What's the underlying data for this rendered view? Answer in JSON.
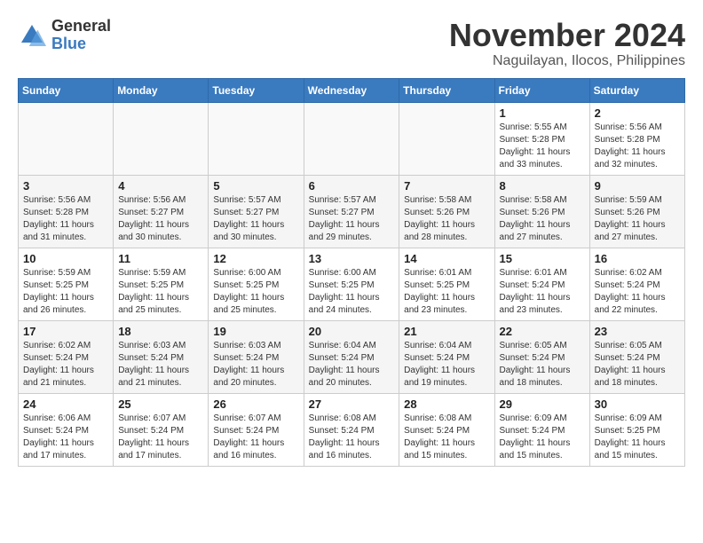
{
  "logo": {
    "line1": "General",
    "line2": "Blue"
  },
  "title": "November 2024",
  "location": "Naguilayan, Ilocos, Philippines",
  "weekdays": [
    "Sunday",
    "Monday",
    "Tuesday",
    "Wednesday",
    "Thursday",
    "Friday",
    "Saturday"
  ],
  "weeks": [
    [
      {
        "day": "",
        "info": ""
      },
      {
        "day": "",
        "info": ""
      },
      {
        "day": "",
        "info": ""
      },
      {
        "day": "",
        "info": ""
      },
      {
        "day": "",
        "info": ""
      },
      {
        "day": "1",
        "info": "Sunrise: 5:55 AM\nSunset: 5:28 PM\nDaylight: 11 hours\nand 33 minutes."
      },
      {
        "day": "2",
        "info": "Sunrise: 5:56 AM\nSunset: 5:28 PM\nDaylight: 11 hours\nand 32 minutes."
      }
    ],
    [
      {
        "day": "3",
        "info": "Sunrise: 5:56 AM\nSunset: 5:28 PM\nDaylight: 11 hours\nand 31 minutes."
      },
      {
        "day": "4",
        "info": "Sunrise: 5:56 AM\nSunset: 5:27 PM\nDaylight: 11 hours\nand 30 minutes."
      },
      {
        "day": "5",
        "info": "Sunrise: 5:57 AM\nSunset: 5:27 PM\nDaylight: 11 hours\nand 30 minutes."
      },
      {
        "day": "6",
        "info": "Sunrise: 5:57 AM\nSunset: 5:27 PM\nDaylight: 11 hours\nand 29 minutes."
      },
      {
        "day": "7",
        "info": "Sunrise: 5:58 AM\nSunset: 5:26 PM\nDaylight: 11 hours\nand 28 minutes."
      },
      {
        "day": "8",
        "info": "Sunrise: 5:58 AM\nSunset: 5:26 PM\nDaylight: 11 hours\nand 27 minutes."
      },
      {
        "day": "9",
        "info": "Sunrise: 5:59 AM\nSunset: 5:26 PM\nDaylight: 11 hours\nand 27 minutes."
      }
    ],
    [
      {
        "day": "10",
        "info": "Sunrise: 5:59 AM\nSunset: 5:25 PM\nDaylight: 11 hours\nand 26 minutes."
      },
      {
        "day": "11",
        "info": "Sunrise: 5:59 AM\nSunset: 5:25 PM\nDaylight: 11 hours\nand 25 minutes."
      },
      {
        "day": "12",
        "info": "Sunrise: 6:00 AM\nSunset: 5:25 PM\nDaylight: 11 hours\nand 25 minutes."
      },
      {
        "day": "13",
        "info": "Sunrise: 6:00 AM\nSunset: 5:25 PM\nDaylight: 11 hours\nand 24 minutes."
      },
      {
        "day": "14",
        "info": "Sunrise: 6:01 AM\nSunset: 5:25 PM\nDaylight: 11 hours\nand 23 minutes."
      },
      {
        "day": "15",
        "info": "Sunrise: 6:01 AM\nSunset: 5:24 PM\nDaylight: 11 hours\nand 23 minutes."
      },
      {
        "day": "16",
        "info": "Sunrise: 6:02 AM\nSunset: 5:24 PM\nDaylight: 11 hours\nand 22 minutes."
      }
    ],
    [
      {
        "day": "17",
        "info": "Sunrise: 6:02 AM\nSunset: 5:24 PM\nDaylight: 11 hours\nand 21 minutes."
      },
      {
        "day": "18",
        "info": "Sunrise: 6:03 AM\nSunset: 5:24 PM\nDaylight: 11 hours\nand 21 minutes."
      },
      {
        "day": "19",
        "info": "Sunrise: 6:03 AM\nSunset: 5:24 PM\nDaylight: 11 hours\nand 20 minutes."
      },
      {
        "day": "20",
        "info": "Sunrise: 6:04 AM\nSunset: 5:24 PM\nDaylight: 11 hours\nand 20 minutes."
      },
      {
        "day": "21",
        "info": "Sunrise: 6:04 AM\nSunset: 5:24 PM\nDaylight: 11 hours\nand 19 minutes."
      },
      {
        "day": "22",
        "info": "Sunrise: 6:05 AM\nSunset: 5:24 PM\nDaylight: 11 hours\nand 18 minutes."
      },
      {
        "day": "23",
        "info": "Sunrise: 6:05 AM\nSunset: 5:24 PM\nDaylight: 11 hours\nand 18 minutes."
      }
    ],
    [
      {
        "day": "24",
        "info": "Sunrise: 6:06 AM\nSunset: 5:24 PM\nDaylight: 11 hours\nand 17 minutes."
      },
      {
        "day": "25",
        "info": "Sunrise: 6:07 AM\nSunset: 5:24 PM\nDaylight: 11 hours\nand 17 minutes."
      },
      {
        "day": "26",
        "info": "Sunrise: 6:07 AM\nSunset: 5:24 PM\nDaylight: 11 hours\nand 16 minutes."
      },
      {
        "day": "27",
        "info": "Sunrise: 6:08 AM\nSunset: 5:24 PM\nDaylight: 11 hours\nand 16 minutes."
      },
      {
        "day": "28",
        "info": "Sunrise: 6:08 AM\nSunset: 5:24 PM\nDaylight: 11 hours\nand 15 minutes."
      },
      {
        "day": "29",
        "info": "Sunrise: 6:09 AM\nSunset: 5:24 PM\nDaylight: 11 hours\nand 15 minutes."
      },
      {
        "day": "30",
        "info": "Sunrise: 6:09 AM\nSunset: 5:25 PM\nDaylight: 11 hours\nand 15 minutes."
      }
    ]
  ]
}
